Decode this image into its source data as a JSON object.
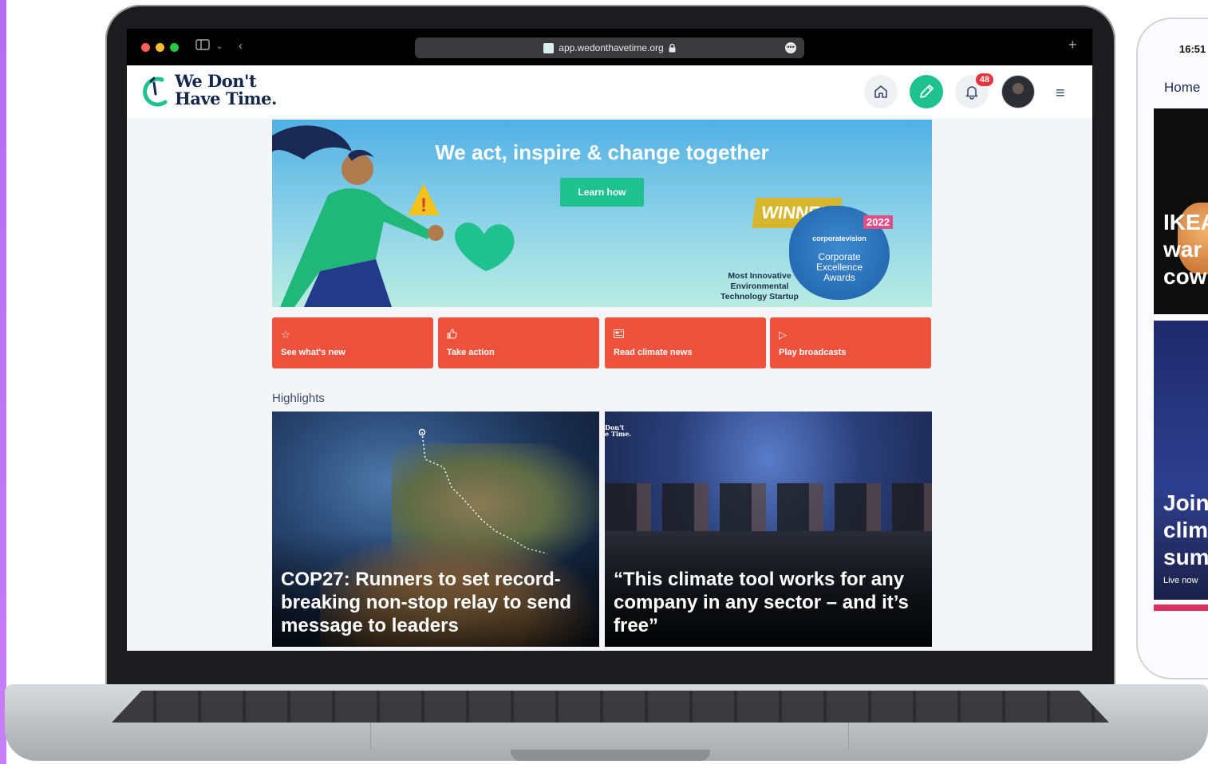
{
  "browser": {
    "url": "app.wedonthavetime.org",
    "more_label": "•••",
    "new_tab_label": "+"
  },
  "app": {
    "logo_line1": "We Don't",
    "logo_line2": "Have Time.",
    "notification_count": "48",
    "icons": [
      "home-icon",
      "pencil-icon",
      "bell-icon",
      "menu-icon"
    ]
  },
  "hero": {
    "title": "We act, inspire & change together",
    "cta_label": "Learn how",
    "winner_label": "WINNER",
    "year": "2022",
    "award_brand": "corporatevision",
    "award_line1": "Corporate",
    "award_line2": "Excellence",
    "award_line3": "Awards",
    "category_line1": "Most Innovative",
    "category_line2": "Environmental",
    "category_line3": "Technology Startup"
  },
  "quick_actions": [
    {
      "label": "See what's new",
      "icon": "star-icon"
    },
    {
      "label": "Take action",
      "icon": "thumbs-up-icon"
    },
    {
      "label": "Read climate news",
      "icon": "newspaper-icon"
    },
    {
      "label": "Play broadcasts",
      "icon": "play-icon"
    }
  ],
  "highlights": {
    "title": "Highlights",
    "cards": [
      {
        "caption": "COP27: Runners to set record-breaking non-stop relay to send message to leaders"
      },
      {
        "caption": "“This climate tool works for any company in any sector – and it’s free”",
        "watermark1": "Don't",
        "watermark2": "e Time."
      }
    ]
  },
  "phone": {
    "time": "16:51",
    "home_label": "Home",
    "story1": "IKEA war cow",
    "story1_l1": "IKEA",
    "story1_l2": "war",
    "story1_l3": "cow",
    "story2_l1": "Join",
    "story2_l2": "clim",
    "story2_l3": "sum",
    "live_label": "Live now"
  },
  "colors": {
    "brand_navy": "#14284b",
    "brand_green": "#1fc18e",
    "action_orange": "#ee523c",
    "badge_red": "#e5353f"
  }
}
